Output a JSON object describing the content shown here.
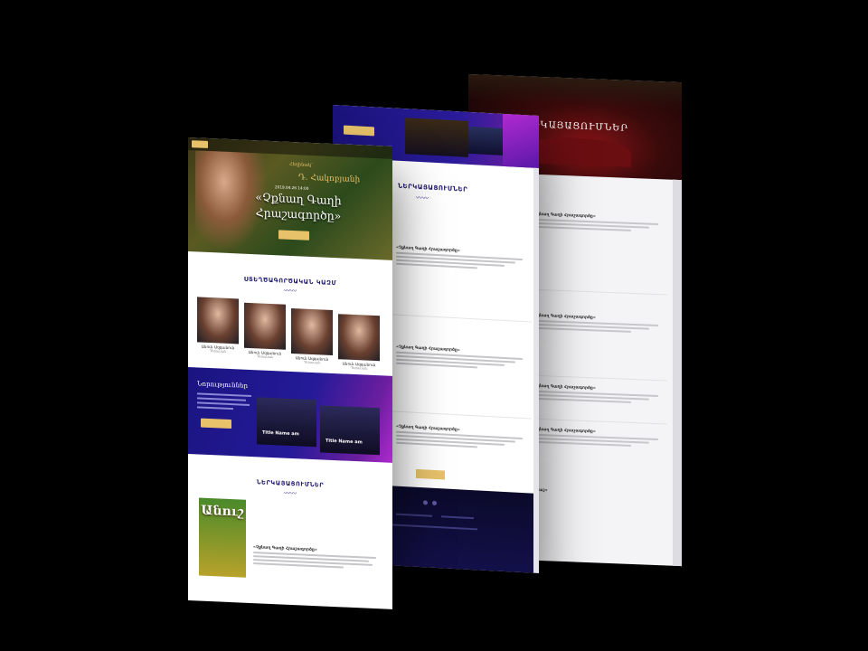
{
  "front": {
    "hero": {
      "subtitle": "Հեղինակ՝",
      "author": "Դ. Հակոբյանի",
      "date": "2019.04.26 14:00",
      "title": "«Չքնաղ Գաղի Հրաշագործը»"
    },
    "team_heading": "ՍՏԵՂԾԱԳՈՐԾԱԿԱՆ ԿԱԶՄ",
    "members": [
      {
        "name": "Անուն Ազգանուն",
        "role": "Դերասան"
      },
      {
        "name": "Անուն Ազգանուն",
        "role": "Դերասան"
      },
      {
        "name": "Անուն Ազգանուն",
        "role": "Դերասան"
      },
      {
        "name": "Անուն Ազգանուն",
        "role": "Դերասան"
      }
    ],
    "news_heading": "Նորություններ",
    "news_items": [
      "Title Name am",
      "Title Name am"
    ],
    "shows_heading": "ՆԵՐԿԱՅԱՑՈՒՄՆԵՐ",
    "poster_title": "Անուշ",
    "event_title": "«Չքնաղ Գաղի Հրաշագործը»"
  },
  "middle": {
    "heading": "ՆԵՐԿԱՅԱՑՈՒՄՆԵՐ",
    "events": [
      "«Չքնաղ Գաղի Հրաշագործը»",
      "«Չքնաղ Գաղի Հրաշագործը»",
      "«Չքնաղ Գաղի Հրաշագործը»"
    ]
  },
  "back": {
    "hero_title": "ՆԵՐԿԱՅԱՑՈՒՄՆԵՐ",
    "events": [
      "«Չքնաղ Գաղի Հրաշագործը»",
      "«Չքնաղ Գաղի Հրաշագործը»",
      "«Չքնաղ Գաղի Հրաշագործը»",
      "«Չքնաղ Գաղի Հրաշագործը»"
    ],
    "tail": "...նաշ»"
  },
  "colors": {
    "background": "#000000",
    "navy": "#1e1a6e",
    "gold": "#e7c26a",
    "purple": "#b02ad0"
  }
}
